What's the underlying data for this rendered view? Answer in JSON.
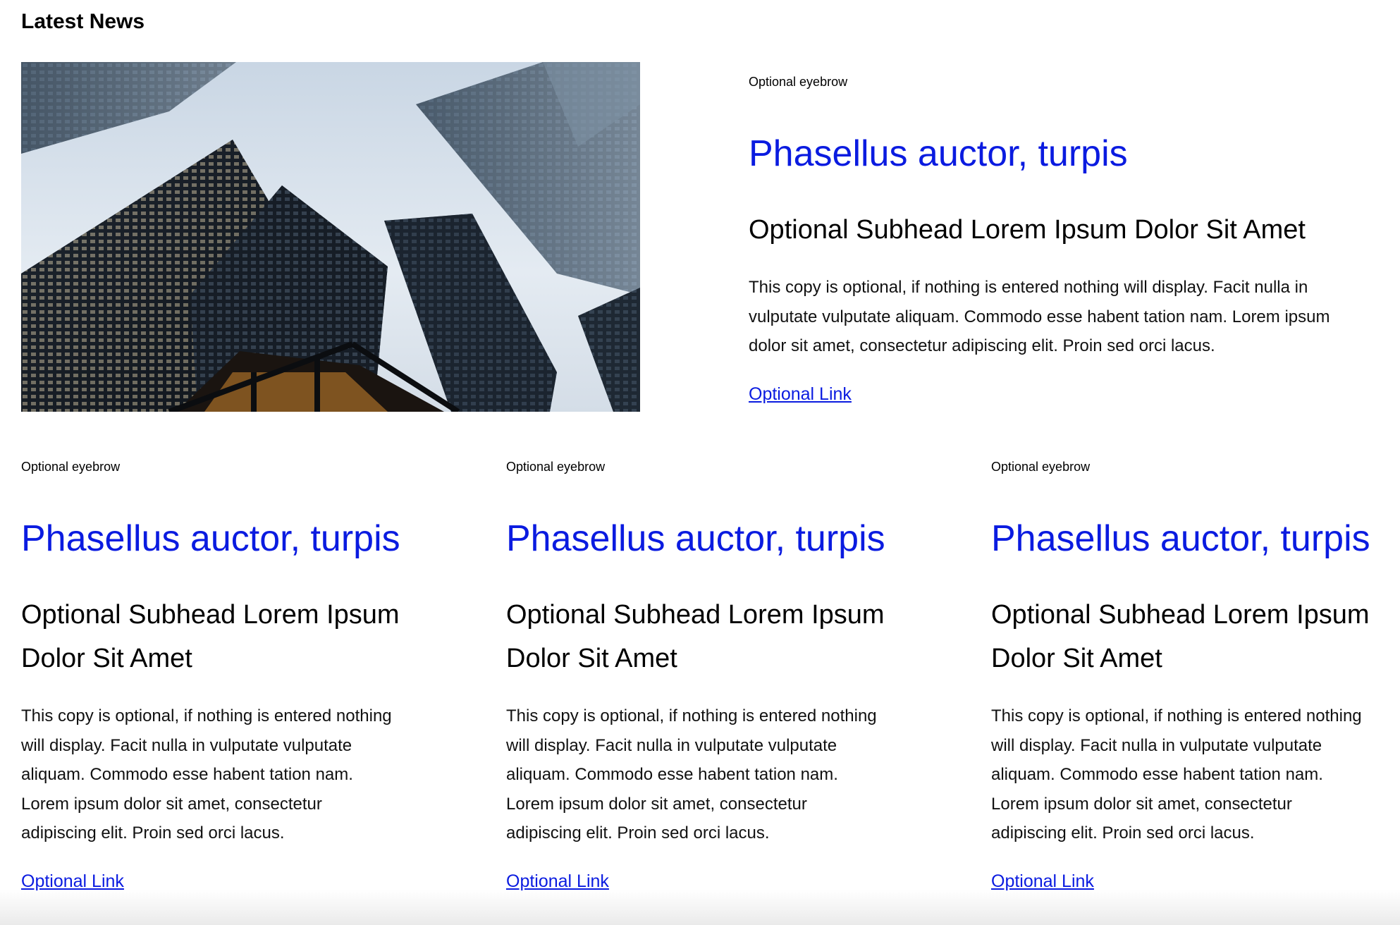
{
  "section": {
    "title": "Latest News"
  },
  "featured": {
    "image": {
      "alt": "",
      "icon": "city-skyscrapers-photo"
    },
    "eyebrow": "Optional eyebrow",
    "headline": "Phasellus auctor, turpis",
    "subhead": "Optional Subhead Lorem Ipsum Dolor Sit Amet",
    "body": "This copy is optional, if nothing is entered nothing will display. Facit nulla in vulputate vulputate aliquam. Commodo esse habent tation nam. Lorem ipsum dolor sit amet, consectetur adipiscing elit. Proin sed orci lacus.",
    "link": "Optional Link"
  },
  "cards": [
    {
      "eyebrow": "Optional eyebrow",
      "headline": "Phasellus auctor, turpis",
      "subhead": "Optional Subhead Lorem Ipsum Dolor Sit Amet",
      "body": "This copy is optional, if nothing is entered nothing will display. Facit nulla in vulputate vulputate aliquam. Commodo esse habent tation nam. Lorem ipsum dolor sit amet, consectetur adipiscing elit. Proin sed orci lacus.",
      "link": "Optional Link"
    },
    {
      "eyebrow": "Optional eyebrow",
      "headline": "Phasellus auctor, turpis",
      "subhead": "Optional Subhead Lorem Ipsum Dolor Sit Amet",
      "body": "This copy is optional, if nothing is entered nothing will display. Facit nulla in vulputate vulputate aliquam. Commodo esse habent tation nam. Lorem ipsum dolor sit amet, consectetur adipiscing elit. Proin sed orci lacus.",
      "link": "Optional Link"
    },
    {
      "eyebrow": "Optional eyebrow",
      "headline": "Phasellus auctor, turpis",
      "subhead": "Optional Subhead Lorem Ipsum Dolor Sit Amet",
      "body": "This copy is optional, if nothing is entered nothing will display. Facit nulla in vulputate vulputate aliquam. Commodo esse habent tation nam. Lorem ipsum dolor sit amet, consectetur adipiscing elit. Proin sed orci lacus.",
      "link": "Optional Link"
    }
  ],
  "colors": {
    "headline": "#0a1be0",
    "link": "#0a1be0",
    "text": "#000000",
    "background": "#ffffff"
  }
}
